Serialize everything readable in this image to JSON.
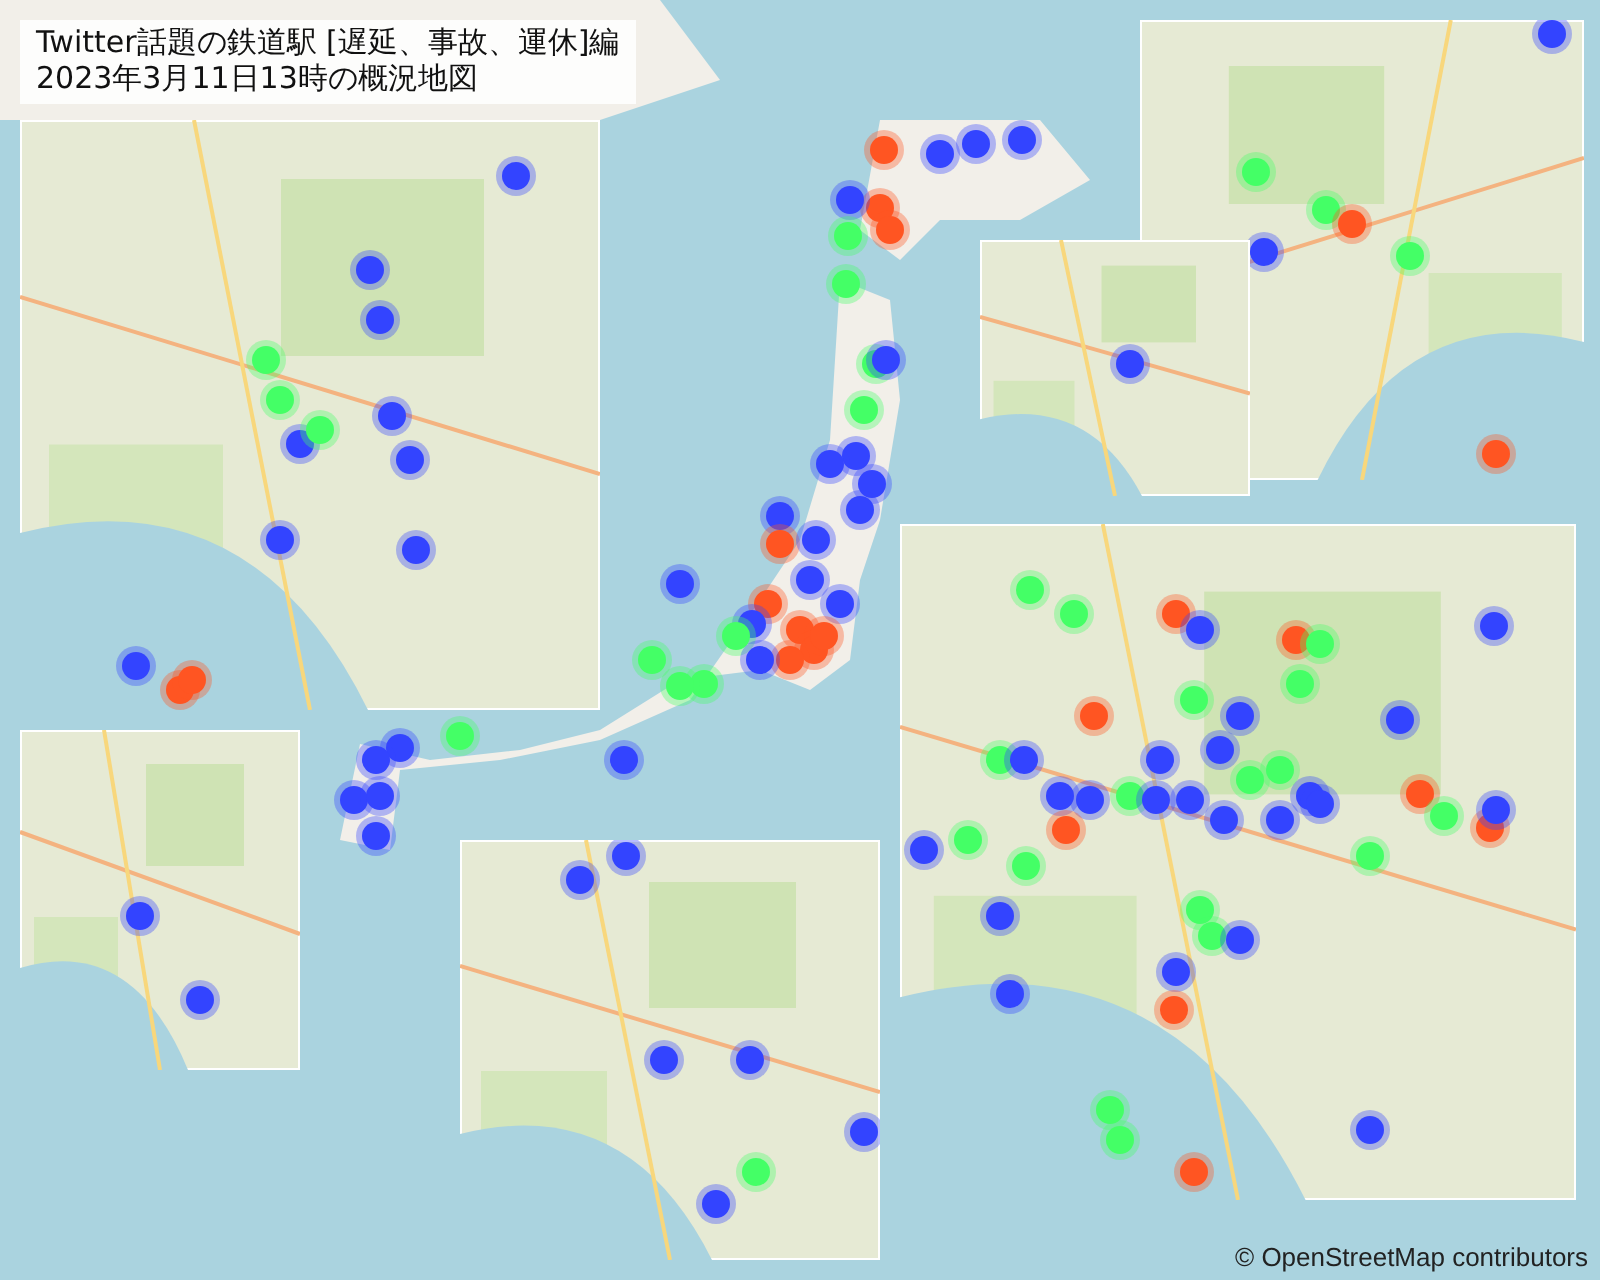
{
  "title": {
    "lines": [
      "Twitter話題の鉄道駅 [遅延、事故、運休]編",
      "2023年3月11日13時の概況地図"
    ]
  },
  "attribution": "© OpenStreetMap contributors"
}
